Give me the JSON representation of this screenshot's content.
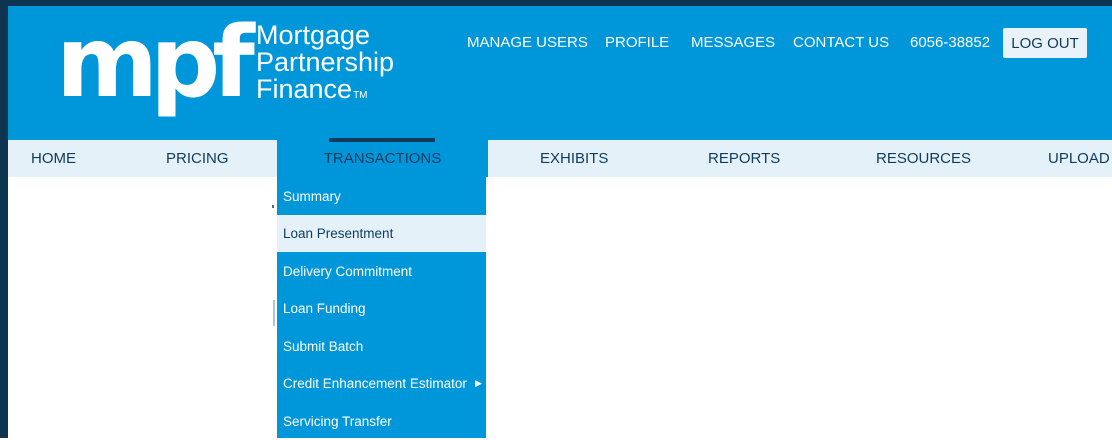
{
  "brand": {
    "logo_mark": "mpf",
    "line1": "Mortgage",
    "line2": "Partnership",
    "line3": "Finance",
    "trademark": "TM"
  },
  "top_links": {
    "manage_users": "MANAGE USERS",
    "profile": "PROFILE",
    "messages": "MESSAGES",
    "contact_us": "CONTACT US",
    "account_id": "6056-38852",
    "logout": "LOG OUT"
  },
  "nav": {
    "home": "HOME",
    "pricing": "PRICING",
    "transactions": "TRANSACTIONS",
    "exhibits": "EXHIBITS",
    "reports": "REPORTS",
    "resources": "RESOURCES",
    "upload": "UPLOAD",
    "active": "TRANSACTIONS"
  },
  "transactions_menu": {
    "items": [
      "Summary",
      "Loan Presentment",
      "Delivery Commitment",
      "Loan Funding",
      "Submit Batch",
      "Credit Enhancement Estimator",
      "Servicing Transfer"
    ],
    "selected": "Loan Presentment",
    "submenu_item": "Credit Enhancement Estimator"
  },
  "colors": {
    "brand_blue": "#0097da",
    "nav_background": "#e5f1f9",
    "nav_text": "#0e3b5e",
    "frame": "#0d3550"
  },
  "icons": {
    "submenu_arrow": "chevron-right-icon"
  }
}
